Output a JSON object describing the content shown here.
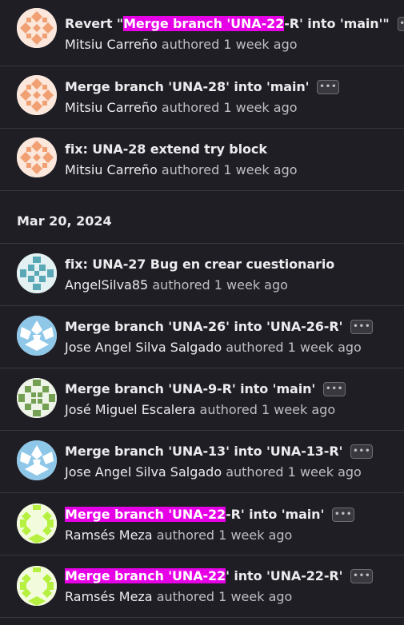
{
  "date_group": "Mar 20, 2024",
  "authored_label": "authored",
  "more_label": "•••",
  "group1": [
    {
      "title_pre": "Revert \"",
      "title_hl": "Merge branch 'UNA-22",
      "title_post": "-R' into 'main'\"",
      "author": "Mitsiu Carreño",
      "time": "1 week ago"
    },
    {
      "title_pre": "Merge branch 'UNA-28' into 'main'",
      "title_hl": "",
      "title_post": "",
      "author": "Mitsiu Carreño",
      "time": "1 week ago"
    },
    {
      "title_pre": "fix: UNA-28 extend try block",
      "title_hl": "",
      "title_post": "",
      "author": "Mitsiu Carreño",
      "time": "1 week ago"
    }
  ],
  "group2": [
    {
      "title_pre": "fix: UNA-27 Bug en crear cuestionario",
      "title_hl": "",
      "title_post": "",
      "author": "AngelSilva85",
      "time": "1 week ago"
    },
    {
      "title_pre": "Merge branch 'UNA-26' into 'UNA-26-R'",
      "title_hl": "",
      "title_post": "",
      "author": "Jose Angel Silva Salgado",
      "time": "1 week ago"
    },
    {
      "title_pre": "Merge branch 'UNA-9-R' into 'main'",
      "title_hl": "",
      "title_post": "",
      "author": "José Miguel Escalera",
      "time": "1 week ago"
    },
    {
      "title_pre": "Merge branch 'UNA-13' into 'UNA-13-R'",
      "title_hl": "",
      "title_post": "",
      "author": "Jose Angel Silva Salgado",
      "time": "1 week ago"
    },
    {
      "title_pre": "",
      "title_hl": "Merge branch 'UNA-22",
      "title_post": "-R' into 'main'",
      "author": "Ramsés Meza",
      "time": "1 week ago"
    },
    {
      "title_pre": "",
      "title_hl": "Merge branch 'UNA-22",
      "title_post": "' into 'UNA-22-R'",
      "author": "Ramsés Meza",
      "time": "1 week ago"
    }
  ],
  "colors": {
    "background": "#1f1e24",
    "highlight": "#e600e6",
    "avatar_orange": "#f0a072",
    "avatar_teal": "#5aa7b5",
    "avatar_blue": "#8ec7e8",
    "avatar_green": "#73a052",
    "avatar_lime": "#b6f040"
  }
}
